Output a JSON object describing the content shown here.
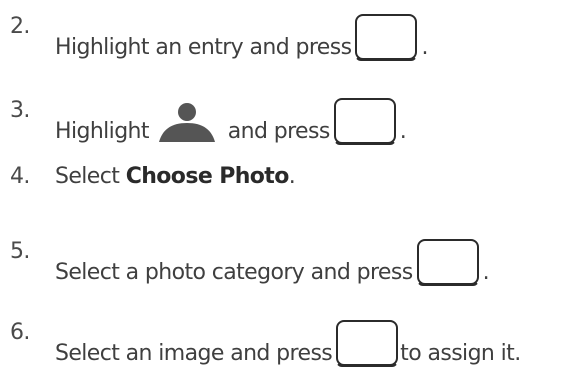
{
  "steps": [
    {
      "number": "2.",
      "before": "Highlight an entry and press",
      "after": "."
    },
    {
      "number": "3.",
      "before": "Highlight",
      "icon": "person-icon",
      "middle": "and press",
      "after": "."
    },
    {
      "number": "4.",
      "before": "Select",
      "bold": "Choose Photo",
      "after": "."
    },
    {
      "number": "5.",
      "before": "Select a photo category and press",
      "after": "."
    },
    {
      "number": "6.",
      "before": "Select an image and press",
      "after": "to assign it."
    }
  ],
  "colors": {
    "text": "#3f3f3f",
    "icon": "#555555",
    "key_border": "#2b2b2b"
  }
}
